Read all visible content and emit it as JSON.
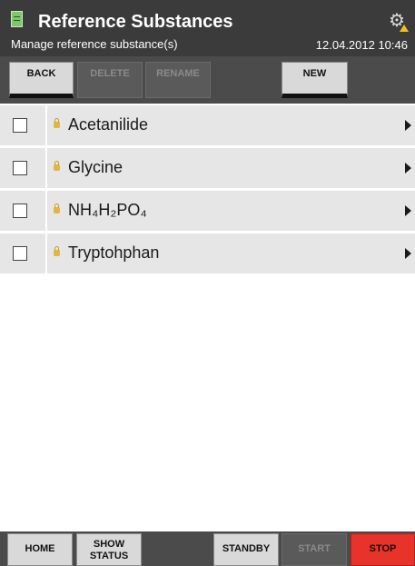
{
  "header": {
    "title": "Reference Substances",
    "subtitle": "Manage reference substance(s)",
    "datetime": "12.04.2012 10:46",
    "icons": {
      "app": "document-list-icon",
      "settings": "gear-warning-icon"
    }
  },
  "toolbar": {
    "back": "BACK",
    "delete": "DELETE",
    "rename": "RENAME",
    "new": "NEW"
  },
  "list": {
    "items": [
      {
        "label": "Acetanilide",
        "checked": false
      },
      {
        "label": "Glycine",
        "checked": false
      },
      {
        "label": "NH₄H₂PO₄",
        "checked": false
      },
      {
        "label": "Tryptohphan",
        "checked": false
      }
    ]
  },
  "bottombar": {
    "home": "HOME",
    "show_status_1": "SHOW",
    "show_status_2": "STATUS",
    "standby": "STANDBY",
    "start": "START",
    "stop": "STOP"
  },
  "colors": {
    "header_bg": "#3b3b3b",
    "row_bg": "#e6e6e6",
    "stop_red": "#e8332a",
    "lock_yellow": "#e2b640"
  }
}
